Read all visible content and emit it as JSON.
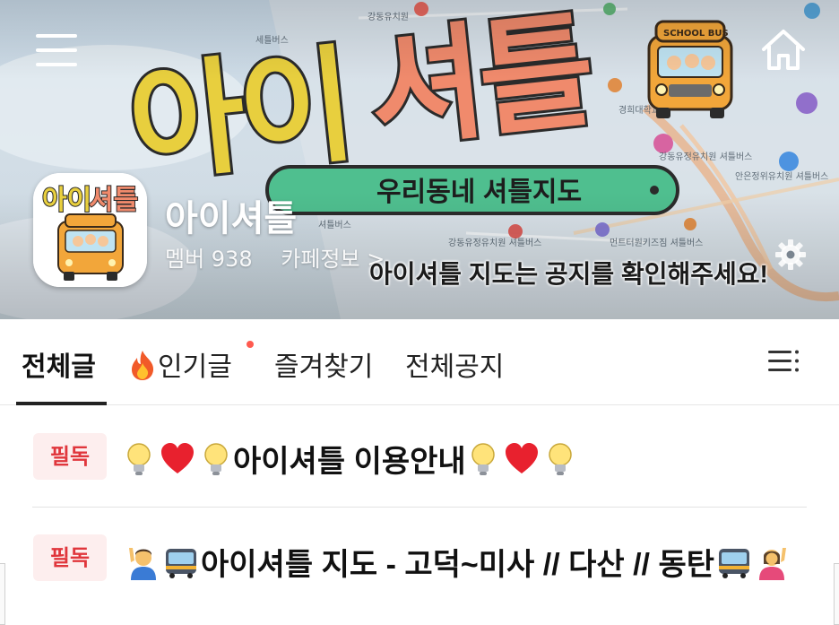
{
  "header": {
    "cafe_name": "아이셔틀",
    "member_label": "멤버 938",
    "info_link": "카페정보 >",
    "banner_notice": "아이셔틀 지도는 공지를 확인해주세요!",
    "banner_art": {
      "logo_text": "아이셔틀",
      "subtitle": "우리동네 셔틀지도",
      "bus_sign": "SCHOOL BUS",
      "map_labels": [
        "강동유치원",
        "세틀버스",
        "경희대학교",
        "강동유정유치원",
        "셔틀버스",
        "강동유정유치원 셔틀버스",
        "안은정위유치원 셔틀버스",
        "강동유정유치원 셔틀버스",
        "먼트터원키즈짐 셔틀버스"
      ]
    },
    "icons": [
      "menu-icon",
      "home-icon",
      "gear-icon"
    ]
  },
  "tabs": {
    "items": [
      {
        "label": "전체글",
        "active": true
      },
      {
        "label": "인기글",
        "icon": "fire-icon",
        "has_new_dot": true
      },
      {
        "label": "즐겨찾기"
      },
      {
        "label": "전체공지"
      }
    ],
    "menu_icon": "list-menu-icon"
  },
  "posts": [
    {
      "badge": "필독",
      "title_text": "아이셔틀 이용안내",
      "leading_emoji": [
        "lightbulb-icon",
        "heart-icon",
        "lightbulb-icon"
      ],
      "trailing_emoji": [
        "lightbulb-icon",
        "heart-icon",
        "lightbulb-icon"
      ]
    },
    {
      "badge": "필독",
      "title_text": "아이셔틀 지도 - 고덕~미사 // 다산 // 동탄",
      "leading_emoji": [
        "person-raising-hand-icon",
        "bus-icon"
      ],
      "trailing_emoji": [
        "bus-icon",
        "person-raising-hand-icon"
      ]
    }
  ],
  "colors": {
    "badge_bg": "#fdeeee",
    "badge_text": "#e0363c",
    "new_dot": "#ff5a4f",
    "logo_yellow": "#e8cf3e",
    "logo_salmon": "#f08a6c",
    "subtitle_green": "#4fbf8f"
  }
}
